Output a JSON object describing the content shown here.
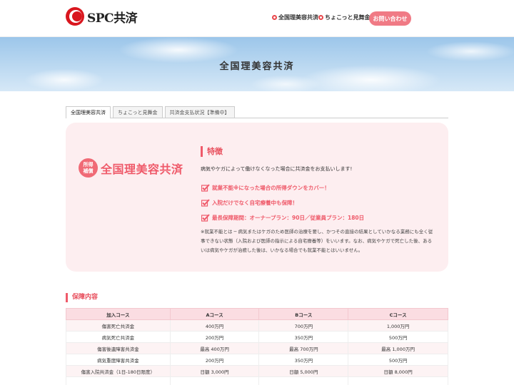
{
  "header": {
    "logo_text": "SPC共済",
    "nav": [
      {
        "label": "全国理美容共済"
      },
      {
        "label": "ちょこっと見舞金"
      }
    ],
    "contact_label": "お問い合わせ"
  },
  "hero": {
    "title": "全国理美容共済"
  },
  "tabs": [
    {
      "label": "全国理美容共済",
      "active": true
    },
    {
      "label": "ちょこっと見舞金",
      "active": false
    },
    {
      "label": "共済金支払状況【準備中】",
      "active": false
    }
  ],
  "feature": {
    "badge_line1": "所得",
    "badge_line2": "補償",
    "brand_title": "全国理美容共済",
    "heading": "特徴",
    "description": "病気やケガによって働けなくなった場合に共済金をお支払いします!",
    "points": [
      "就業不能※になった場合の所得ダウンをカバー！",
      "入院だけでなく自宅療養中も保障！",
      "最長保障期間：オーナープラン：90日／従業員プラン：180日"
    ],
    "note": "※就業不能とは ─ 病気またはケガのため医師の治療を要し、かつその直接の結果としていかなる業務にも全く従事できない状態（入院および医師の指示による自宅療養等）をいいます。なお、病気やケガで死亡した後、あるいは病気やケガが治癒した後は、いかなる場合でも就業不能とはいいません。"
  },
  "coverage": {
    "heading": "保障内容",
    "columns": [
      "加入コース",
      "Aコース",
      "Bコース",
      "Cコース"
    ],
    "rows": [
      [
        "傷害死亡共済金",
        "400万円",
        "700万円",
        "1,000万円"
      ],
      [
        "病気死亡共済金",
        "200万円",
        "350万円",
        "500万円"
      ],
      [
        "傷害後遺障害共済金",
        "最高 400万円",
        "最高 700万円",
        "最高 1,000万円"
      ],
      [
        "病気重度障害共済金",
        "200万円",
        "350万円",
        "500万円"
      ],
      [
        "傷害入院共済金（1日-180日限度）",
        "日額 3,000円",
        "日額 5,000円",
        "日額 8,000円"
      ],
      [
        "",
        "",
        "",
        ""
      ]
    ]
  },
  "colors": {
    "accent": "#ef5a6a",
    "header_btn": "#f07a85",
    "card_bg": "#fdeef0"
  }
}
